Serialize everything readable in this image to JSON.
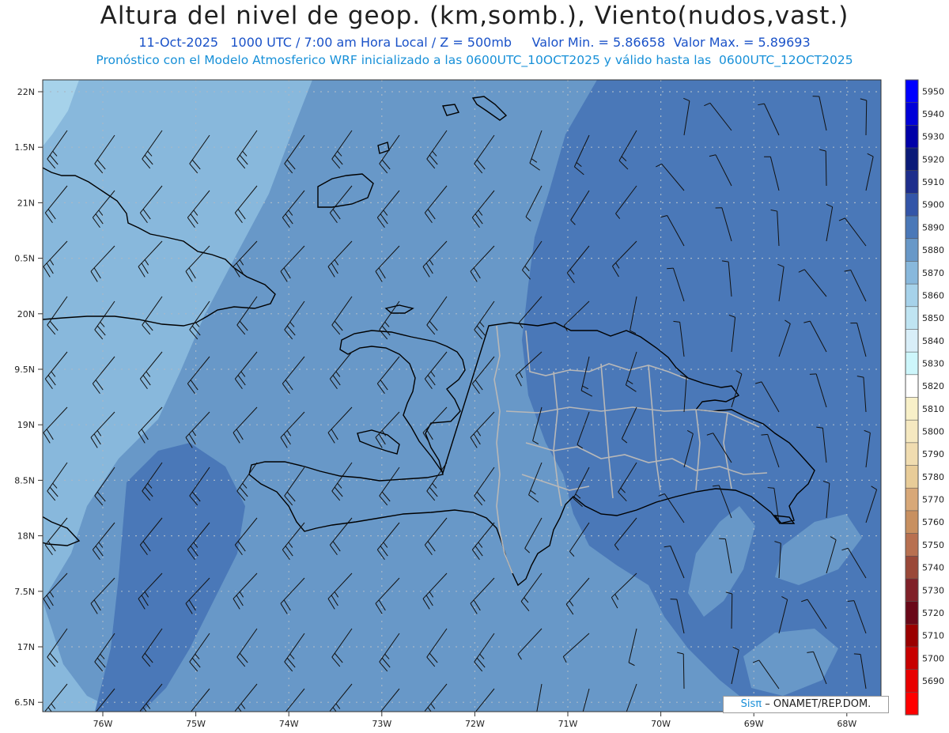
{
  "header": {
    "title": "Altura del nivel de geop. (km,somb.), Viento(nudos,vast.)",
    "line1": "11-Oct-2025   1000 UTC / 7:00 am Hora Local / Z = 500mb     Valor Min. = 5.86658  Valor Max. = 5.89693",
    "line2": "Pronóstico con el Modelo Atmosferico WRF inicializado a las 0600UTC_10OCT2025 y válido hasta las  0600UTC_12OCT2025"
  },
  "map": {
    "lat_labels": [
      "22N",
      "1.5N",
      "21N",
      "0.5N",
      "20N",
      "9.5N",
      "19N",
      "8.5N",
      "18N",
      "7.5N",
      "17N",
      "6.5N"
    ],
    "lon_labels": [
      "76W",
      "75W",
      "74W",
      "73W",
      "72W",
      "71W",
      "70W",
      "69W",
      "68W"
    ]
  },
  "colorbar": {
    "levels": [
      "5950",
      "5940",
      "5930",
      "5920",
      "5910",
      "5900",
      "5890",
      "5880",
      "5870",
      "5860",
      "5850",
      "5840",
      "5830",
      "5820",
      "5810",
      "5800",
      "5790",
      "5780",
      "5770",
      "5760",
      "5750",
      "5740",
      "5730",
      "5720",
      "5710",
      "5700",
      "5690"
    ],
    "colors": [
      "#0000ff",
      "#0000d8",
      "#0000a8",
      "#0a1a78",
      "#1e2e8c",
      "#3355a8",
      "#4a78b8",
      "#6898c8",
      "#88b8dc",
      "#a6d2ea",
      "#bfe4f2",
      "#d8eef8",
      "#cdf6fb",
      "#ffffff",
      "#f8f0c8",
      "#f5e8c0",
      "#f0dcb0",
      "#e8cc98",
      "#d8a878",
      "#c89060",
      "#b87050",
      "#9a4838",
      "#802028",
      "#6a0818",
      "#9a0000",
      "#c80000",
      "#e80000",
      "#ff0000"
    ]
  },
  "credit": {
    "brand": "Sisπ",
    "text": "– ONAMET/REP.DOM."
  }
}
